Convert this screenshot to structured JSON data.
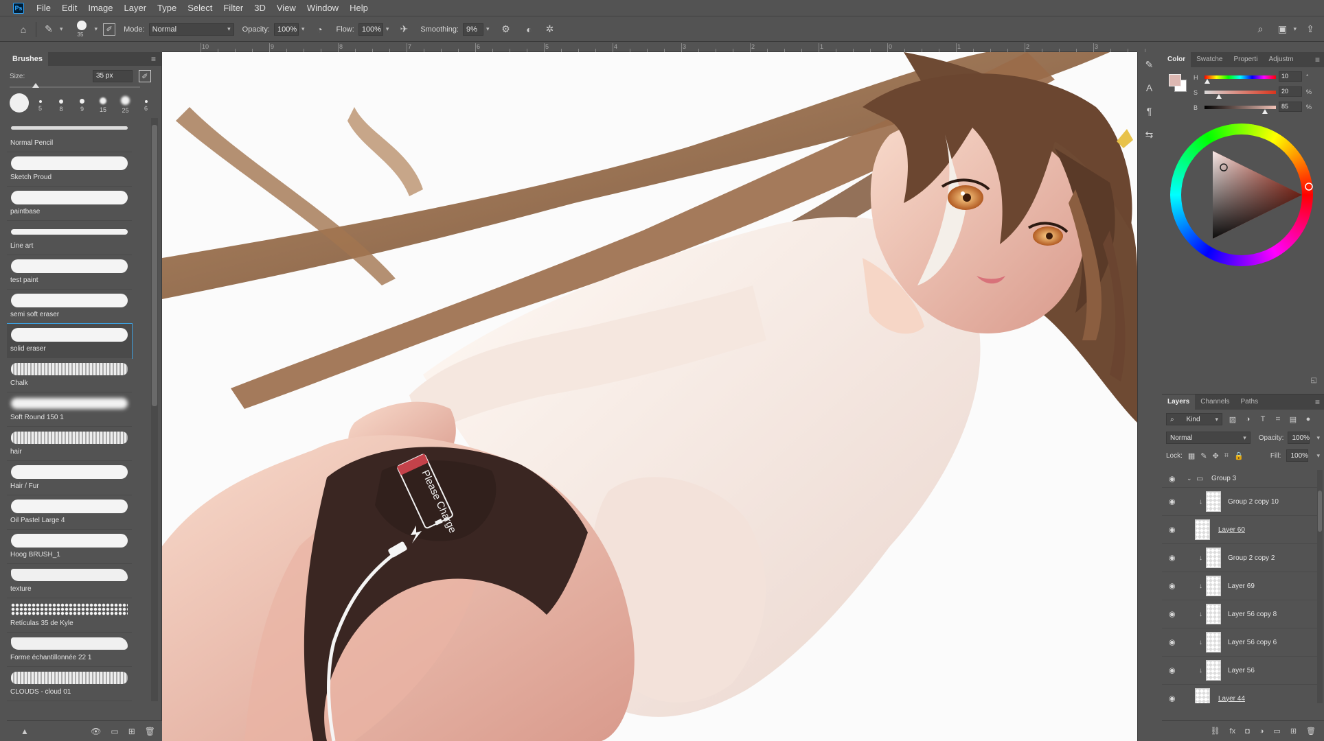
{
  "app": {
    "logo": "Ps"
  },
  "menu": [
    "File",
    "Edit",
    "Image",
    "Layer",
    "Type",
    "Select",
    "Filter",
    "3D",
    "View",
    "Window",
    "Help"
  ],
  "options": {
    "brush_size": "35",
    "mode_label": "Mode:",
    "mode_value": "Normal",
    "opacity_label": "Opacity:",
    "opacity_value": "100%",
    "flow_label": "Flow:",
    "flow_value": "100%",
    "smoothing_label": "Smoothing:",
    "smoothing_value": "9%"
  },
  "ruler": [
    "10",
    "9",
    "8",
    "7",
    "6",
    "5",
    "4",
    "3",
    "2",
    "1",
    "0",
    "1",
    "2",
    "3"
  ],
  "brushes": {
    "tab": "Brushes",
    "size_label": "Size:",
    "size_value": "35 px",
    "tips": [
      "5",
      "8",
      "9",
      "15",
      "25",
      "6"
    ],
    "items": [
      {
        "name": "Normal Pencil",
        "style": "pencil"
      },
      {
        "name": "Sketch Proud",
        "style": "solid"
      },
      {
        "name": "paintbase",
        "style": "solid"
      },
      {
        "name": "Line art",
        "style": "thin"
      },
      {
        "name": "test paint",
        "style": "solid"
      },
      {
        "name": "semi soft eraser",
        "style": "solid"
      },
      {
        "name": "solid eraser",
        "style": "solid",
        "selected": true
      },
      {
        "name": "Chalk",
        "style": "chalk"
      },
      {
        "name": "Soft Round 150 1",
        "style": "soft"
      },
      {
        "name": "hair",
        "style": "chalk"
      },
      {
        "name": "Hair / Fur",
        "style": "solid"
      },
      {
        "name": "Oil Pastel Large 4",
        "style": "solid"
      },
      {
        "name": "Hoog BRUSH_1",
        "style": "solid"
      },
      {
        "name": "texture",
        "style": "rough"
      },
      {
        "name": "Retículas 35 de Kyle",
        "style": "dots"
      },
      {
        "name": "Forme échantillonnée 22 1",
        "style": "rough"
      },
      {
        "name": "CLOUDS - cloud 01",
        "style": "chalk"
      }
    ]
  },
  "canvas": {
    "label_text": "Please Charge"
  },
  "color": {
    "tabs": [
      "Color",
      "Swatche",
      "Properti",
      "Adjustm"
    ],
    "h_label": "H",
    "h_value": "10",
    "h_unit": "°",
    "s_label": "S",
    "s_value": "20",
    "s_unit": "%",
    "b_label": "B",
    "b_value": "85",
    "b_unit": "%",
    "foreground": "#ddb8b2"
  },
  "layers": {
    "tabs": [
      "Layers",
      "Channels",
      "Paths"
    ],
    "filter_kind": "Kind",
    "blend_mode": "Normal",
    "opacity_label": "Opacity:",
    "opacity_value": "100%",
    "lock_label": "Lock:",
    "fill_label": "Fill:",
    "fill_value": "100%",
    "items": [
      {
        "name": "Group 3",
        "type": "group"
      },
      {
        "name": "Group 2 copy 10",
        "clipped": true
      },
      {
        "name": "Layer 60",
        "clipped": false,
        "underline": true
      },
      {
        "name": "Group 2 copy 2",
        "clipped": true
      },
      {
        "name": "Layer 69",
        "clipped": true
      },
      {
        "name": "Layer 56 copy 8",
        "clipped": true
      },
      {
        "name": "Layer 56 copy 6",
        "clipped": true
      },
      {
        "name": "Layer 56",
        "clipped": true
      },
      {
        "name": "Layer 44",
        "clipped": false,
        "underline": true
      }
    ]
  }
}
